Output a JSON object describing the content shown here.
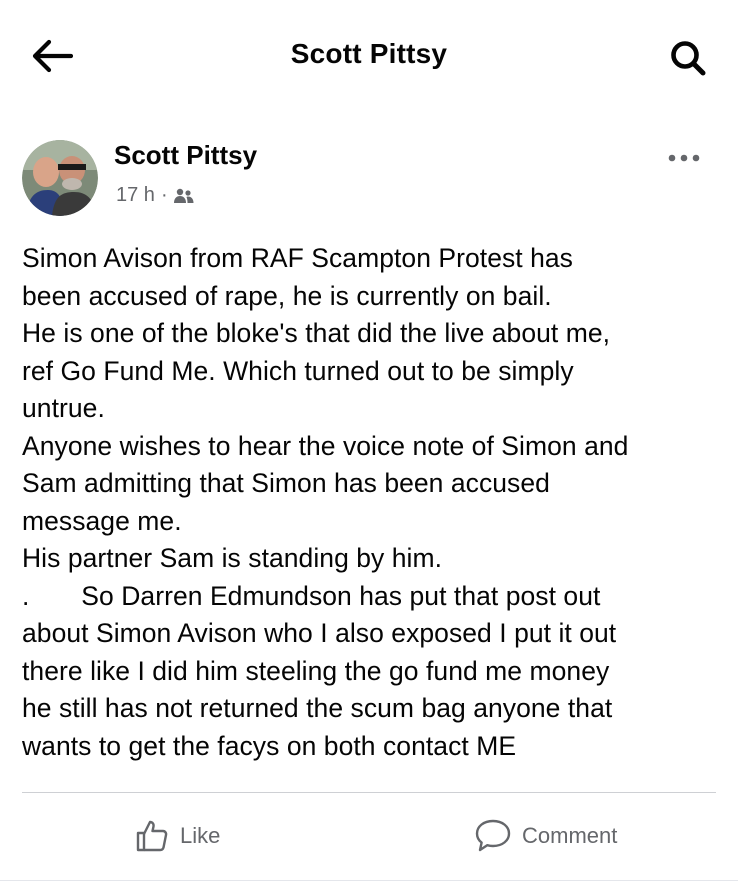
{
  "appbar": {
    "title": "Scott Pittsy",
    "back_icon": "arrow-left-icon",
    "search_icon": "search-icon"
  },
  "post": {
    "author": "Scott Pittsy",
    "time": "17 h",
    "separator": "·",
    "audience_icon": "friends-icon",
    "more_icon": "more-horizontal-icon",
    "body_lines": [
      "Simon Avison from RAF Scampton Protest has",
      "been accused of rape, he is currently on bail.",
      "He is one of the bloke's that did the live about me,",
      "ref Go Fund Me. Which turned out to be simply",
      "untrue.",
      "Anyone wishes to hear the voice note of Simon and",
      "Sam admitting that Simon has been accused",
      "message me.",
      "His partner Sam is standing by him.",
      ".       So Darren Edmundson has put that post out",
      "about Simon Avison who I also exposed I put it out",
      "there like I did him steeling the go fund me money",
      "he still has not returned the scum bag anyone that",
      "wants to get the facys on both contact ME"
    ]
  },
  "actions": {
    "like_label": "Like",
    "like_icon": "thumbs-up-icon",
    "comment_label": "Comment",
    "comment_icon": "comment-bubble-icon"
  },
  "colors": {
    "text": "#050505",
    "secondary_text": "#65676b",
    "divider": "#ced0d4"
  }
}
